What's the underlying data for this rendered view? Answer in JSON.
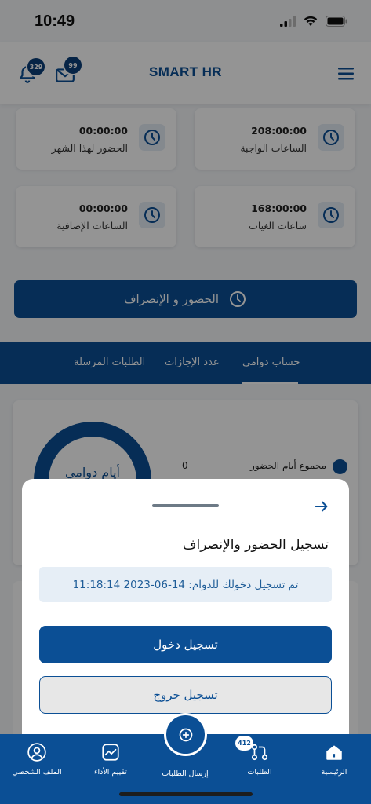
{
  "status_bar": {
    "time": "10:49"
  },
  "header": {
    "title": "SMART HR",
    "notification_count": "329",
    "messages_count": "99"
  },
  "stats": [
    {
      "value": "00:00:00",
      "label": "الحضور لهذا الشهر",
      "icon": "clock-icon"
    },
    {
      "value": "208:00:00",
      "label": "الساعات الواجبة",
      "icon": "clock-icon"
    },
    {
      "value": "00:00:00",
      "label": "الساعات الإضافية",
      "icon": "clock-icon"
    },
    {
      "value": "168:00:00",
      "label": "ساعات الغياب",
      "icon": "clock-icon"
    }
  ],
  "attendance_button": {
    "label": "الحضور و الإنصراف"
  },
  "tabs": [
    {
      "label": "حساب دوامي",
      "active": true
    },
    {
      "label": "عدد الإجازات",
      "active": false
    },
    {
      "label": "الطلبات المرسلة",
      "active": false
    }
  ],
  "summary_card": {
    "donut_label": "أيام دوامي",
    "legend_label": "مجموع أيام الحضور",
    "legend_value": "0"
  },
  "sheet": {
    "title": "تسجيل الحضور والإنصراف",
    "notice": "تم تسجيل دخولك للدوام: 14-06-2023 11:18:14",
    "check_in_label": "تسجيل دخول",
    "check_out_label": "تسجيل خروج"
  },
  "bottom_nav": {
    "items": [
      {
        "label": "الملف الشخصي",
        "icon": "profile-icon"
      },
      {
        "label": "تقييم الأداء",
        "icon": "performance-icon"
      },
      {
        "label": "إرسال الطلبات",
        "icon": "add-icon"
      },
      {
        "label": "الطلبات",
        "icon": "requests-icon"
      },
      {
        "label": "الرئيسية",
        "icon": "home-icon"
      }
    ],
    "requests_badge": "412"
  },
  "colors": {
    "primary": "#0b4f95",
    "background": "#f4f6f9",
    "notice_bg": "#e6eef6"
  }
}
